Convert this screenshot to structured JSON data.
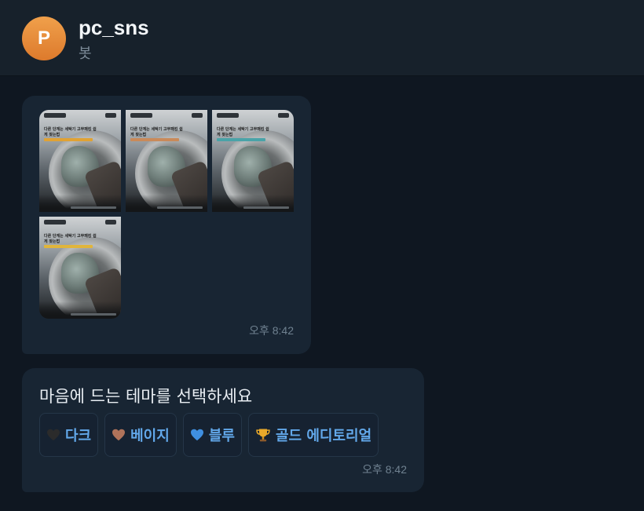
{
  "header": {
    "avatar_letter": "P",
    "title": "pc_sns",
    "subtitle": "봇",
    "avatar_color": "#e78c3a"
  },
  "messages": [
    {
      "type": "album",
      "images": [
        {
          "headline": "다른 단계는 세탁기 고무패킹 쉽게 찾는법",
          "accent": "#e0a234"
        },
        {
          "headline": "다른 단계는 세탁기 고무패킹 쉽게 찾는법",
          "accent": "#c98a5a"
        },
        {
          "headline": "다른 단계는 세탁기 고무패킹 쉽게 찾는법",
          "accent": "#4aa3a8"
        },
        {
          "headline": "다른 단계는 세탁기 고무패킹 쉽게 찾는법",
          "accent": "#e0b53b"
        }
      ],
      "time": "오후 8:42"
    },
    {
      "type": "text",
      "text": "마음에 드는 테마를 선택하세요",
      "time": "오후 8:42",
      "buttons": [
        {
          "icon": "black-heart-icon",
          "label": "다크",
          "color": "#2b2b2b"
        },
        {
          "icon": "brown-heart-icon",
          "label": "베이지",
          "color": "#b0735a"
        },
        {
          "icon": "blue-heart-icon",
          "label": "블루",
          "color": "#3f8fe0"
        },
        {
          "icon": "trophy-icon",
          "label": "골드 에디토리얼",
          "color": "#e9a92a"
        }
      ]
    }
  ]
}
